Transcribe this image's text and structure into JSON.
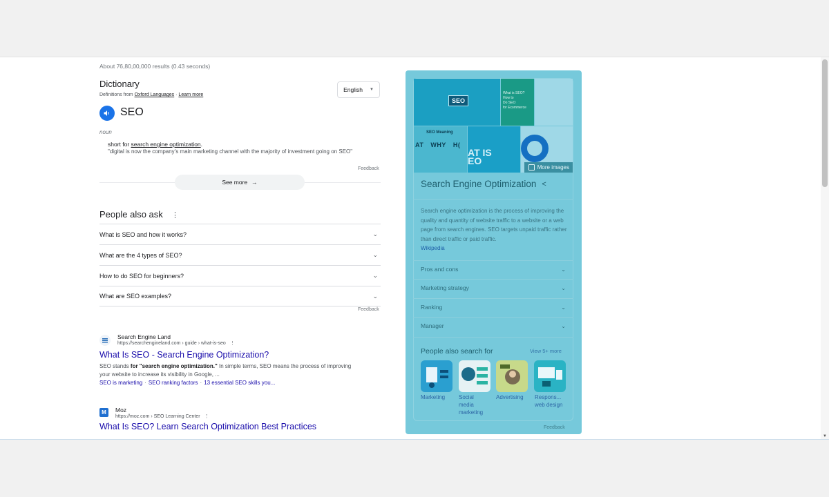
{
  "results_stats": "About 76,80,00,000 results (0.43 seconds)",
  "dictionary": {
    "title": "Dictionary",
    "source_prefix": "Definitions from ",
    "source_name": "Oxford Languages",
    "source_sep": " · ",
    "learn_more": "Learn more",
    "language": "English",
    "word": "SEO",
    "part_of_speech": "noun",
    "definition_prefix": "short for ",
    "definition_link": "search engine optimization",
    "definition_suffix": ".",
    "example": "\"digital is now the company's main marketing channel with the majority of investment going on SEO\"",
    "feedback": "Feedback",
    "see_more": "See more"
  },
  "people_also_ask": {
    "title": "People also ask",
    "questions": [
      "What is SEO and how it works?",
      "What are the 4 types of SEO?",
      "How to do SEO for beginners?",
      "What are SEO examples?"
    ],
    "feedback": "Feedback"
  },
  "results": [
    {
      "site": "Search Engine Land",
      "url": "https://searchengineland.com › guide › what-is-seo",
      "title": "What Is SEO - Search Engine Optimization?",
      "snippet_a": "SEO stands ",
      "snippet_bold": "for \"search engine optimization.\"",
      "snippet_b": " In simple terms, SEO means the process of improving your website to increase its visibility in Google, ...",
      "links": [
        "SEO is marketing",
        "SEO ranking factors",
        "13 essential SEO skills you..."
      ]
    },
    {
      "site": "Moz",
      "url": "https://moz.com › SEO Learning Center",
      "title": "What Is SEO? Learn Search Optimization Best Practices",
      "favicon_letter": "M"
    }
  ],
  "knowledge_panel": {
    "image_text": {
      "seo_badge": "SEO",
      "what_is_seo": "What is SEO?",
      "how_to": "How to",
      "do_seo": "Do SEO",
      "for_ecommerce": "for Ecommerce",
      "seo_meaning": "SEO Meaning",
      "at": "AT",
      "why": "WHY",
      "h": "H(",
      "what_is": "AT IS",
      "eo": "EO"
    },
    "more_images": "More images",
    "title": "Search Engine Optimization",
    "description": "Search engine optimization is the process of improving the quality and quantity of website traffic to a website or a web page from search engines. SEO targets unpaid traffic rather than direct traffic or paid traffic.",
    "source": "Wikipedia",
    "rows": [
      "Pros and cons",
      "Marketing strategy",
      "Ranking",
      "Manager"
    ],
    "people_also_search": {
      "title": "People also search for",
      "view_more": "View 5+ more",
      "items": [
        {
          "label_1": "Marketing",
          "label_2": "",
          "label_3": ""
        },
        {
          "label_1": "Social",
          "label_2": "media",
          "label_3": "marketing"
        },
        {
          "label_1": "Advertising",
          "label_2": "",
          "label_3": ""
        },
        {
          "label_1": "Respons...",
          "label_2": "web design",
          "label_3": ""
        }
      ]
    },
    "feedback": "Feedback"
  },
  "colors": {
    "link": "#1a0dab",
    "panel_bg": "#76c9db",
    "accent": "#1a73e8"
  }
}
